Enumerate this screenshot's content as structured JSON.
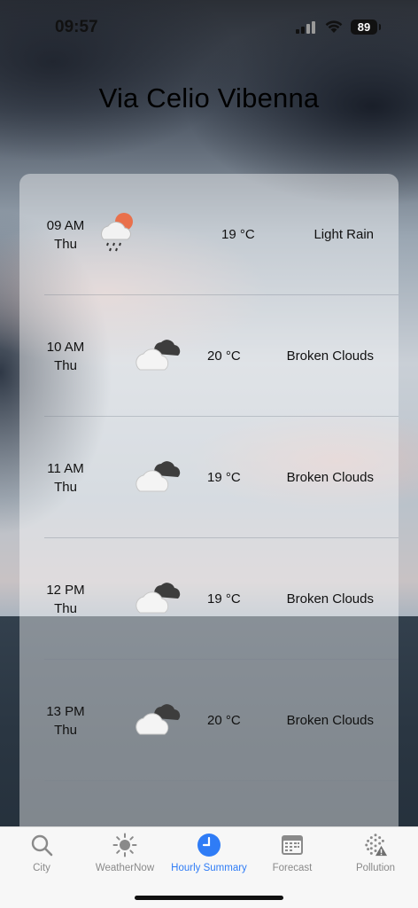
{
  "status_bar": {
    "time": "09:57",
    "battery": "89"
  },
  "title": "Via Celio Vibenna",
  "hourly": [
    {
      "hour": "09 AM",
      "day": "Thu",
      "icon": "light-rain-icon",
      "temp": "19 °C",
      "desc": "Light Rain"
    },
    {
      "hour": "10 AM",
      "day": "Thu",
      "icon": "broken-clouds-icon",
      "temp": "20 °C",
      "desc": "Broken Clouds"
    },
    {
      "hour": "11 AM",
      "day": "Thu",
      "icon": "broken-clouds-icon",
      "temp": "19 °C",
      "desc": "Broken Clouds"
    },
    {
      "hour": "12 PM",
      "day": "Thu",
      "icon": "broken-clouds-icon",
      "temp": "19 °C",
      "desc": "Broken Clouds"
    },
    {
      "hour": "13 PM",
      "day": "Thu",
      "icon": "broken-clouds-icon",
      "temp": "20 °C",
      "desc": "Broken Clouds"
    }
  ],
  "tabs": [
    {
      "label": "City",
      "icon": "search-icon"
    },
    {
      "label": "WeatherNow",
      "icon": "sun-icon"
    },
    {
      "label": "Hourly Summary",
      "icon": "clock-icon",
      "active": true
    },
    {
      "label": "Forecast",
      "icon": "calendar-icon"
    },
    {
      "label": "Pollution",
      "icon": "pollution-warning-icon"
    }
  ],
  "colors": {
    "accent": "#2f7cf6",
    "inactive": "#8a8a8a",
    "sun": "#e9704b"
  }
}
